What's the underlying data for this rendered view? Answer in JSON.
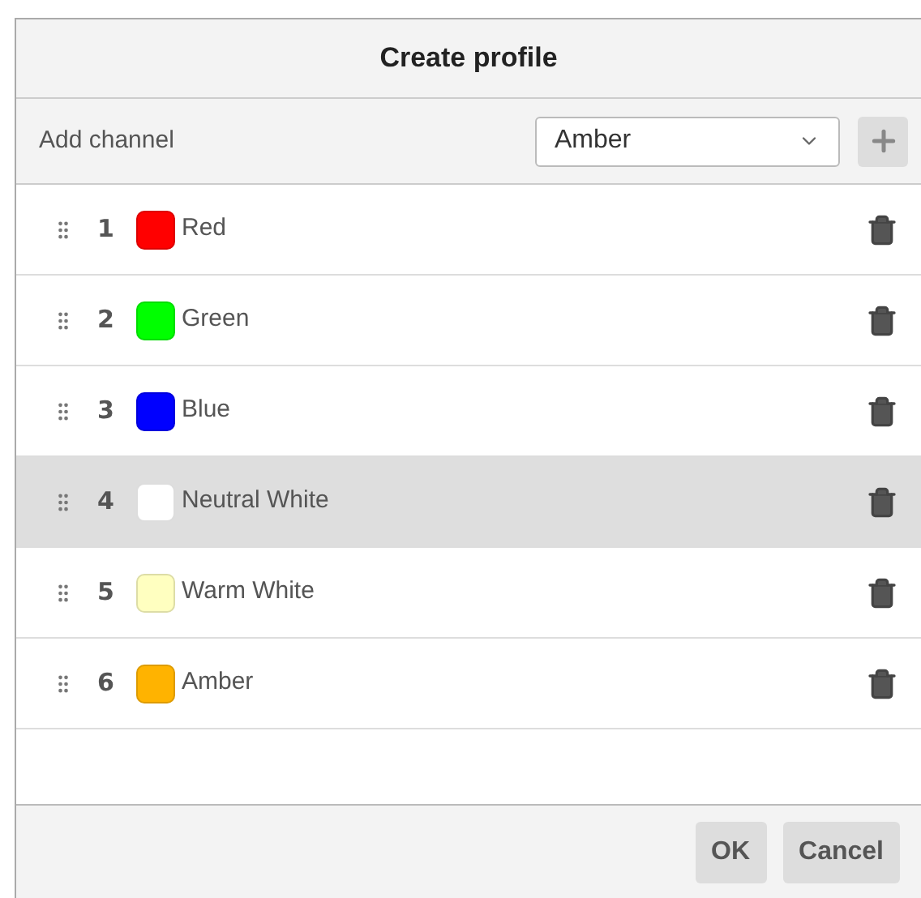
{
  "dialog": {
    "title": "Create profile"
  },
  "add_channel": {
    "label": "Add channel",
    "value": "Amber"
  },
  "channels": [
    {
      "number": "1",
      "name": "Red",
      "color": "#ff0000",
      "selected": false
    },
    {
      "number": "2",
      "name": "Green",
      "color": "#00ff00",
      "selected": false
    },
    {
      "number": "3",
      "name": "Blue",
      "color": "#0000ff",
      "selected": false
    },
    {
      "number": "4",
      "name": "Neutral White",
      "color": "#ffffff",
      "selected": true
    },
    {
      "number": "5",
      "name": "Warm White",
      "color": "#ffffc0",
      "selected": false
    },
    {
      "number": "6",
      "name": "Amber",
      "color": "#ffb300",
      "selected": false
    }
  ],
  "buttons": [
    "OK",
    "Cancel"
  ]
}
